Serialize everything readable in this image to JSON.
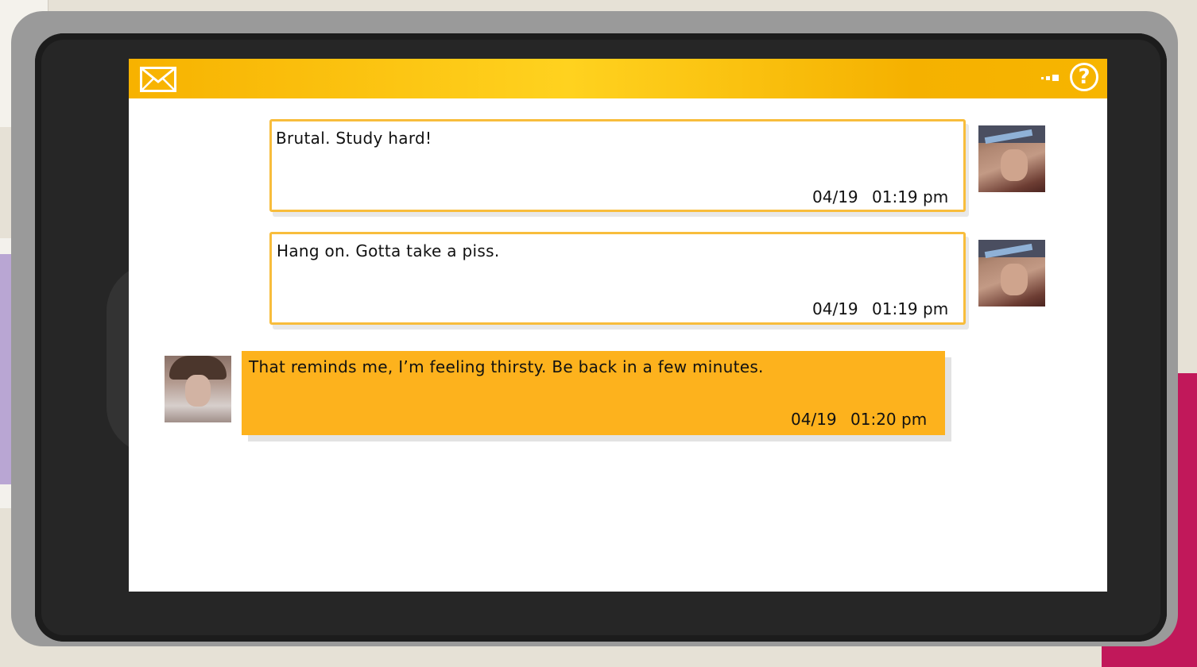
{
  "header": {
    "mail_icon": "envelope-icon",
    "signal_icon": "signal-dots-icon",
    "help_label": "?"
  },
  "messages": [
    {
      "sender": "chloe",
      "text": "Brutal.  Study hard!",
      "date": "04/19",
      "time": "01:19 pm",
      "style": "incoming"
    },
    {
      "sender": "chloe",
      "text": "Hang on.  Gotta take a piss.",
      "date": "04/19",
      "time": "01:19 pm",
      "style": "incoming"
    },
    {
      "sender": "max",
      "text": "That reminds me, I’m feeling thirsty.  Be back in a few minutes.",
      "date": "04/19",
      "time": "01:20 pm",
      "style": "outgoing"
    }
  ],
  "colors": {
    "accent": "#fdb21d",
    "incoming_border": "#f8bd3c",
    "bezel": "#262626"
  }
}
